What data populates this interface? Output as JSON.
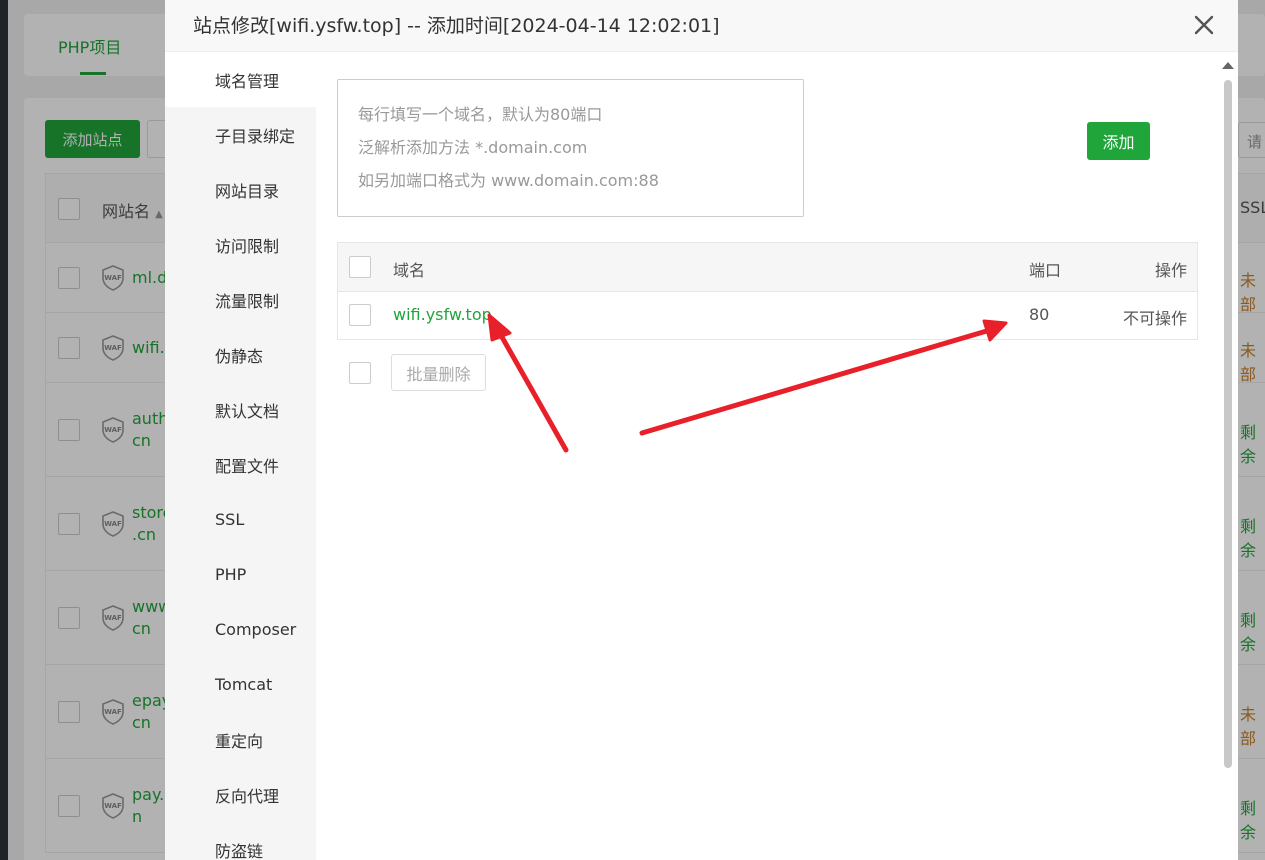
{
  "background": {
    "tab_label": "PHP项目",
    "add_site_label": "添加站点",
    "search_placeholder": "请",
    "column_site_name": "网站名",
    "column_ssl": "SSL",
    "waf_label": "WAF",
    "rows": [
      {
        "name": "ml.d",
        "name2": "",
        "ssl": "未部",
        "ssl_color": "#c8822e"
      },
      {
        "name": "wifi.y",
        "name2": "",
        "ssl": "未部",
        "ssl_color": "#c8822e"
      },
      {
        "name": "auth",
        "name2": "cn",
        "ssl": "剩余",
        "ssl_color": "#20a53a"
      },
      {
        "name": "store",
        "name2": ".cn",
        "ssl": "剩余",
        "ssl_color": "#20a53a"
      },
      {
        "name": "www",
        "name2": "cn",
        "ssl": "剩余",
        "ssl_color": "#20a53a"
      },
      {
        "name": "epay",
        "name2": "cn",
        "ssl": "未部",
        "ssl_color": "#c8822e"
      },
      {
        "name": "pay.",
        "name2": "n",
        "ssl": "剩余",
        "ssl_color": "#20a53a"
      }
    ]
  },
  "modal": {
    "title": "站点修改[wifi.ysfw.top] -- 添加时间[2024-04-14 12:02:01]",
    "menu": [
      {
        "label": "域名管理",
        "active": true
      },
      {
        "label": "子目录绑定"
      },
      {
        "label": "网站目录"
      },
      {
        "label": "访问限制"
      },
      {
        "label": "流量限制"
      },
      {
        "label": "伪静态"
      },
      {
        "label": "默认文档"
      },
      {
        "label": "配置文件"
      },
      {
        "label": "SSL"
      },
      {
        "label": "PHP"
      },
      {
        "label": "Composer"
      },
      {
        "label": "Tomcat"
      },
      {
        "label": "重定向"
      },
      {
        "label": "反向代理"
      },
      {
        "label": "防盗链"
      }
    ],
    "textarea_placeholder": {
      "line1": "每行填写一个域名，默认为80端口",
      "line2": "泛解析添加方法 *.domain.com",
      "line3": "如另加端口格式为 www.domain.com:88"
    },
    "add_button_label": "添加",
    "table": {
      "headers": {
        "domain": "域名",
        "port": "端口",
        "operation": "操作"
      },
      "rows": [
        {
          "domain": "wifi.ysfw.top",
          "port": "80",
          "operation": "不可操作"
        }
      ]
    },
    "bulk_delete_label": "批量删除"
  },
  "colors": {
    "accent": "#20a53a",
    "arrow": "#e8202a"
  }
}
